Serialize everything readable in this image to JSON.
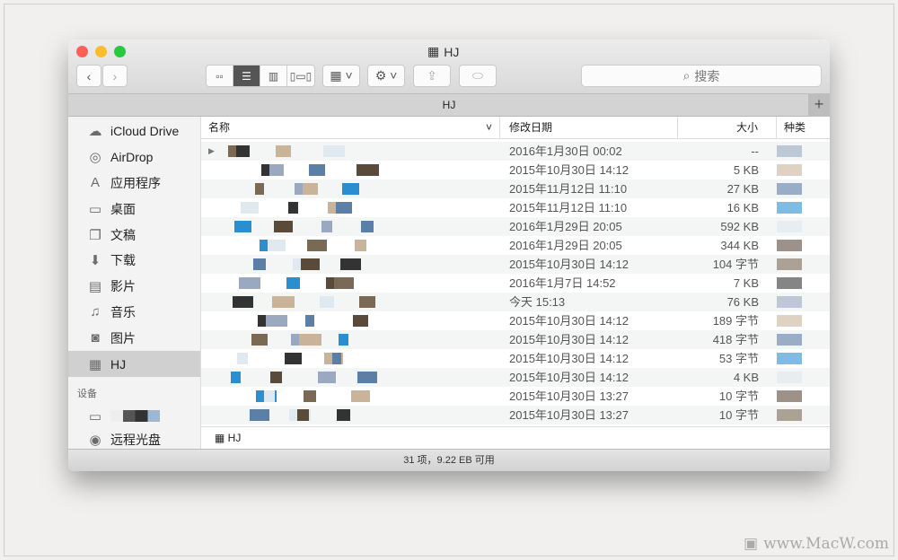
{
  "window": {
    "title": "HJ",
    "tab_title": "HJ",
    "search_placeholder": "搜索",
    "path_label": "HJ",
    "status": "31 项，9.22 EB 可用"
  },
  "sidebar": {
    "items": [
      {
        "label": "iCloud Drive",
        "icon": "cloud-icon"
      },
      {
        "label": "AirDrop",
        "icon": "airdrop-icon"
      },
      {
        "label": "应用程序",
        "icon": "applications-icon"
      },
      {
        "label": "桌面",
        "icon": "desktop-icon"
      },
      {
        "label": "文稿",
        "icon": "documents-icon"
      },
      {
        "label": "下载",
        "icon": "downloads-icon"
      },
      {
        "label": "影片",
        "icon": "movies-icon"
      },
      {
        "label": "音乐",
        "icon": "music-icon"
      },
      {
        "label": "图片",
        "icon": "pictures-icon"
      },
      {
        "label": "HJ",
        "icon": "drive-icon",
        "selected": true
      }
    ],
    "devices_header": "设备",
    "devices": [
      {
        "label": "远程光盘",
        "icon": "disc-icon"
      }
    ]
  },
  "columns": {
    "name": "名称",
    "date": "修改日期",
    "size": "大小",
    "kind": "种类"
  },
  "rows": [
    {
      "date": "2016年1月30日 00:02",
      "size": "--"
    },
    {
      "date": "2015年10月30日 14:12",
      "size": "5 KB"
    },
    {
      "date": "2015年11月12日 11:10",
      "size": "27 KB"
    },
    {
      "date": "2015年11月12日 11:10",
      "size": "16 KB"
    },
    {
      "date": "2016年1月29日 20:05",
      "size": "592 KB"
    },
    {
      "date": "2016年1月29日 20:05",
      "size": "344 KB"
    },
    {
      "date": "2015年10月30日 14:12",
      "size": "104 字节"
    },
    {
      "date": "2016年1月7日 14:52",
      "size": "7 KB"
    },
    {
      "date": "今天 15:13",
      "size": "76 KB"
    },
    {
      "date": "2015年10月30日 14:12",
      "size": "189 字节"
    },
    {
      "date": "2015年10月30日 14:12",
      "size": "418 字节"
    },
    {
      "date": "2015年10月30日 14:12",
      "size": "53 字节"
    },
    {
      "date": "2015年10月30日 14:12",
      "size": "4 KB"
    },
    {
      "date": "2015年10月30日 13:27",
      "size": "10 字节"
    },
    {
      "date": "2015年10月30日 13:27",
      "size": "10 字节"
    }
  ],
  "watermark": "www.MacW.com"
}
